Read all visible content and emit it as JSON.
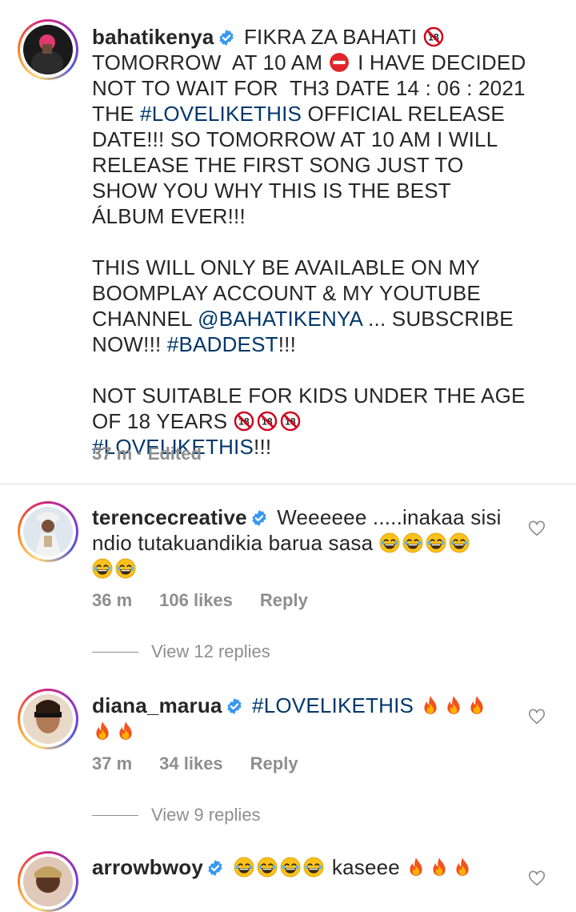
{
  "post": {
    "username": "bahatikenya",
    "caption_1": "FIKRA ZA BAHATI ",
    "caption_2": "\nTOMORROW  AT 10 AM ",
    "caption_3": " I HAVE DECIDED NOT TO WAIT FOR  TH3 DATE 14 : 06 : 2021 THE ",
    "hashtag_1": "#LOVELIKETHIS",
    "caption_4": " OFFICIAL RELEASE DATE!!! SO TOMORROW AT 10 AM I WILL RELEASE THE FIRST SONG JUST TO SHOW YOU WHY THIS IS THE BEST ÁLBUM EVER!!!\n\nTHIS WILL ONLY BE AVAILABLE ON MY BOOMPLAY ACCOUNT & MY YOUTUBE CHANNEL ",
    "mention": "@BAHATIKENYA",
    "caption_5": " ... SUBSCRIBE NOW!!! ",
    "hashtag_2": "#BADDEST",
    "caption_6": "!!!\n\nNOT SUITABLE FOR KIDS UNDER THE AGE OF 18 YEARS ",
    "hashtag_3": "#LOVELIKETHIS",
    "caption_7": "!!!",
    "meta": "37 m · Edited"
  },
  "comments": [
    {
      "username": "terencecreative",
      "text": "Weeeeee .....inakaa sisi ndio tutakuandikia barua sasa ",
      "time": "36 m",
      "likes": "106 likes",
      "reply": "Reply",
      "view_replies": "View 12 replies"
    },
    {
      "username": "diana_marua",
      "hashtag": "#LOVELIKETHIS",
      "time": "37 m",
      "likes": "34 likes",
      "reply": "Reply",
      "view_replies": "View 9 replies"
    },
    {
      "username": "arrowbwoy",
      "text": " kaseee "
    }
  ],
  "colors": {
    "link": "#00376b",
    "meta": "#8e8e8e",
    "verified": "#3897f0",
    "text": "#262626"
  },
  "icons": [
    "verified-badge-icon",
    "no-under-18-icon",
    "no-entry-icon",
    "laughing-emoji-icon",
    "fire-emoji-icon",
    "heart-outline-icon"
  ]
}
